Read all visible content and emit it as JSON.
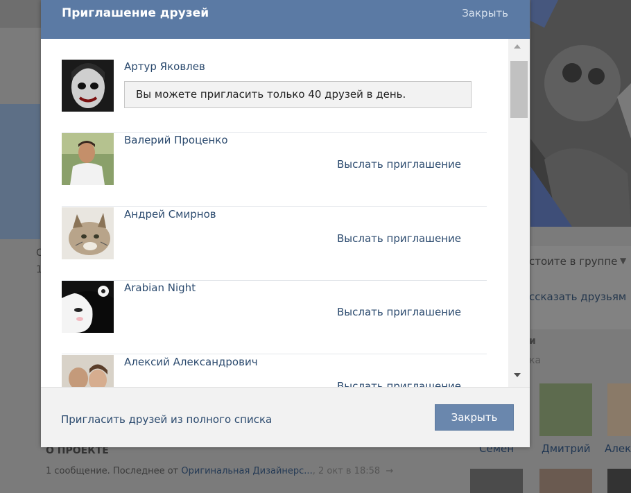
{
  "dialog": {
    "title": "Приглашение друзей",
    "close_link": "Закрыть",
    "friends": [
      {
        "name": "Артур Яковлев",
        "notice": "Вы можете пригласить только 40 друзей в день."
      },
      {
        "name": "Валерий Проценко",
        "action": "Выслать приглашение"
      },
      {
        "name": "Андрей Смирнов",
        "action": "Выслать приглашение"
      },
      {
        "name": "Arabian Night",
        "action": "Выслать приглашение"
      },
      {
        "name": "Алексий Александрович",
        "action": "Выслать приглашение"
      }
    ],
    "footer_link": "Пригласить друзей из полного списка",
    "close_button": "Закрыть"
  },
  "background": {
    "group_link": "стоите в группе",
    "tell_friends": "ссказать друзьям",
    "right_sub": "ка",
    "members": [
      "Семен",
      "Дмитрий",
      "Алек"
    ],
    "about_title": "О ПРОЕКТЕ",
    "message_prefix": "1 сообщение. Последнее от",
    "message_author": "Оригинальная Дизайнерс...",
    "message_time": ", 2 окт в 18:58",
    "left_text_1": "С",
    "left_text_2": "1"
  },
  "icons": {
    "scroll_up": "triangle-up-icon",
    "scroll_down": "triangle-down-icon",
    "dropdown_arrow": "triangle-down-icon"
  },
  "colors": {
    "header": "#5b7aa4",
    "link": "#2b4a6e",
    "button": "#6a87ad"
  }
}
